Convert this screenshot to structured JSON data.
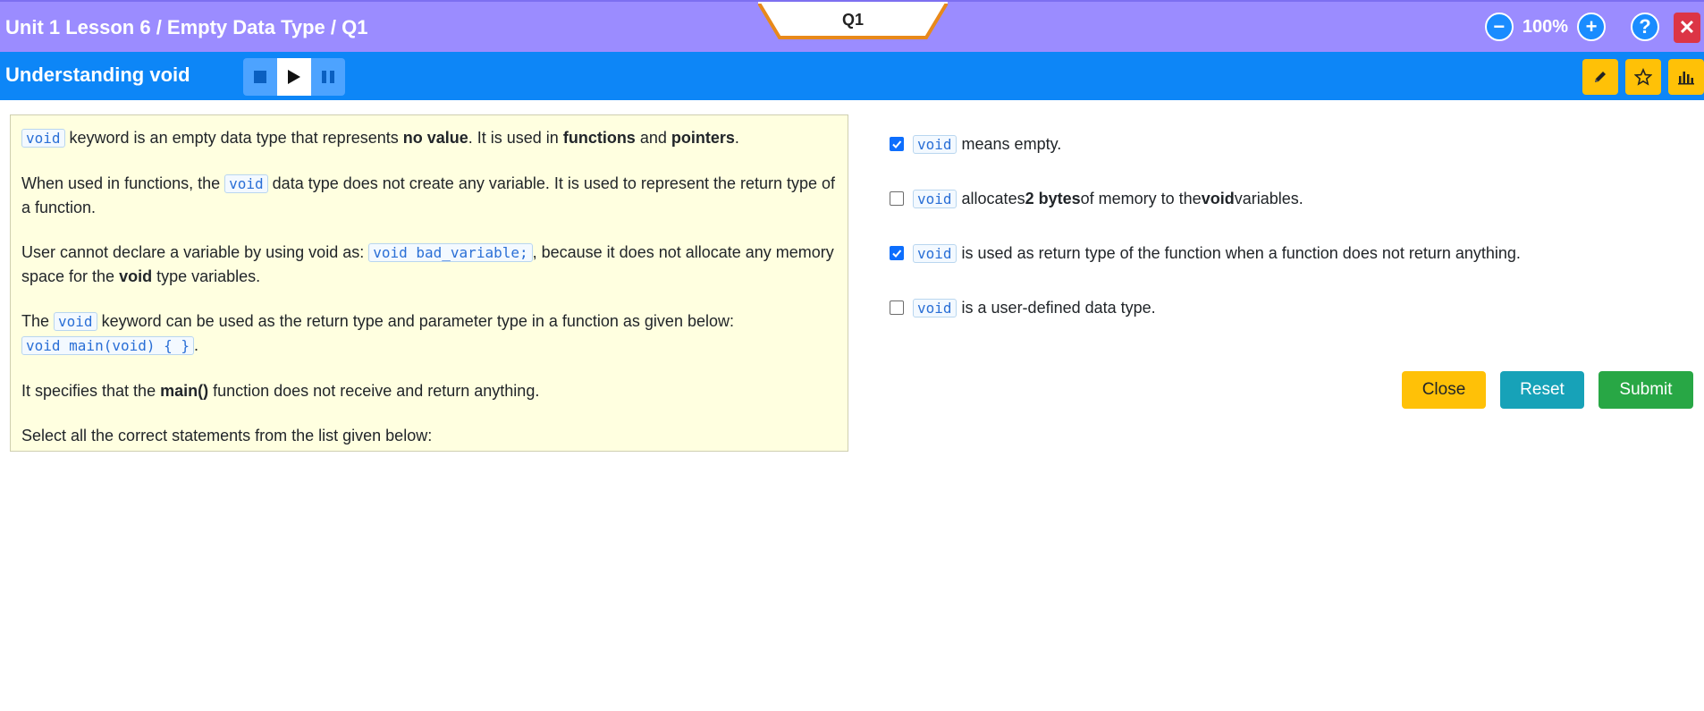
{
  "header": {
    "breadcrumb": "Unit 1 Lesson 6 / Empty Data Type / Q1",
    "question_tab": "Q1",
    "zoom": "100%",
    "zoom_out_glyph": "−",
    "zoom_in_glyph": "+",
    "help_glyph": "?",
    "close_glyph": "✕"
  },
  "subheader": {
    "title": "Understanding void"
  },
  "question": {
    "p1": {
      "code": "void",
      "t1": " keyword is an empty data type that represents ",
      "b1": "no value",
      "t2": ". It is used in ",
      "b2": "functions",
      "t3": " and ",
      "b3": "pointers",
      "t4": "."
    },
    "p2": {
      "t1": "When used in functions, the ",
      "code": "void",
      "t2": " data type does not create any variable. It is used to represent the return type of a function."
    },
    "p3": {
      "t1": "User cannot declare a variable by using void as: ",
      "code": "void bad_variable;",
      "t2": ", because it does not allocate any memory space for the ",
      "b1": "void",
      "t3": " type variables."
    },
    "p4": {
      "t1": "The ",
      "code1": "void",
      "t2": " keyword can be used as the return type and parameter type in a function as given below:",
      "code2": "void main(void) { }",
      "t3": "."
    },
    "p5": {
      "t1": "It specifies that the ",
      "b1": "main()",
      "t2": " function does not receive and return anything."
    },
    "p6": {
      "t1": "Select all the correct statements from the list given below:"
    }
  },
  "options": [
    {
      "checked": true,
      "code": "void",
      "t1": "means empty.",
      "b1": "",
      "t2": "",
      "b2": "",
      "t3": ""
    },
    {
      "checked": false,
      "code": "void",
      "t1": "allocates ",
      "b1": "2 bytes",
      "t2": " of memory to the ",
      "b2": "void",
      "t3": " variables."
    },
    {
      "checked": true,
      "code": "void",
      "t1": "is used as return type of the function when a function does not return anything.",
      "b1": "",
      "t2": "",
      "b2": "",
      "t3": ""
    },
    {
      "checked": false,
      "code": "void",
      "t1": "is a user-defined data type.",
      "b1": "",
      "t2": "",
      "b2": "",
      "t3": ""
    }
  ],
  "actions": {
    "close": "Close",
    "reset": "Reset",
    "submit": "Submit"
  },
  "colors": {
    "header_bg": "#9b8cff",
    "subheader_bg": "#0d86f7",
    "panel_bg": "#ffffe0",
    "accent_yellow": "#ffc107",
    "accent_teal": "#17a2b8",
    "accent_green": "#28a745",
    "accent_red": "#dc3545"
  },
  "icons": [
    "minus-icon",
    "plus-icon",
    "help-icon",
    "close-icon",
    "stop-icon",
    "play-icon",
    "pause-icon",
    "pencil-icon",
    "star-icon",
    "chart-icon"
  ]
}
